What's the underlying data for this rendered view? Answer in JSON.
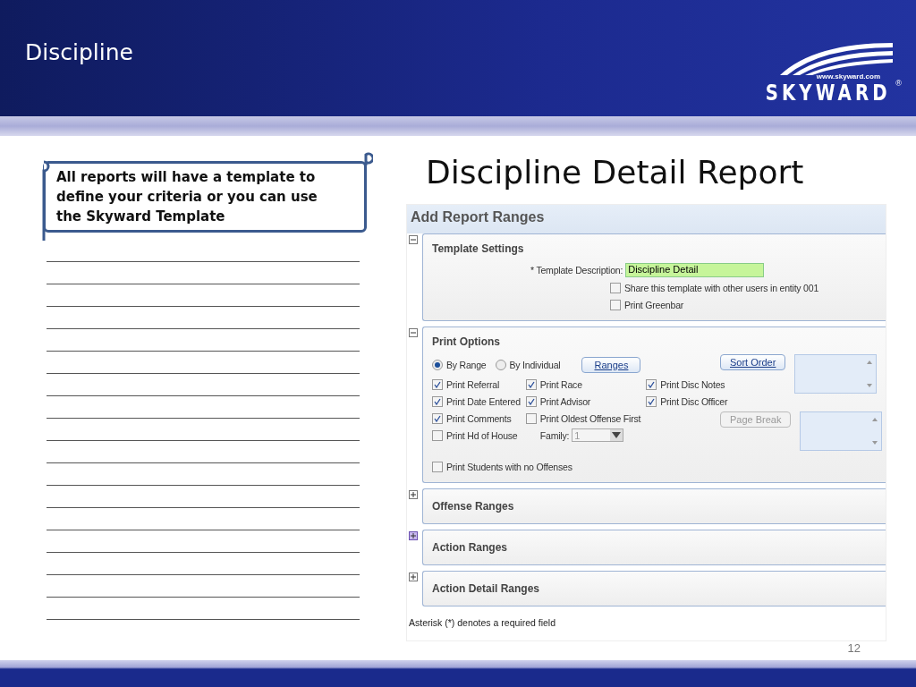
{
  "slide": {
    "title": "Discipline",
    "logo": {
      "url": "www.skyward.com",
      "name": "SKYWARD",
      "mark": "®"
    },
    "callout": "All reports will have a template to define your criteria or you can use the Skyward Template",
    "heading": "Discipline Detail Report",
    "page_number": "12"
  },
  "screenshot": {
    "title": "Add Report Ranges",
    "sections": [
      {
        "kind": "template",
        "title": "Template Settings",
        "expanded": true,
        "hovered": false,
        "required_mark": "*",
        "field_label": "Template Description:",
        "field_value": "Discipline Detail",
        "checkboxes": [
          {
            "label": "Share this template with other users in entity 001",
            "checked": false
          },
          {
            "label": "Print Greenbar",
            "checked": false
          }
        ]
      },
      {
        "kind": "print",
        "title": "Print Options",
        "expanded": true,
        "hovered": false,
        "radios": [
          {
            "label": "By Range",
            "selected": true
          },
          {
            "label": "By Individual",
            "selected": false
          }
        ],
        "ranges_button": "Ranges",
        "columns": [
          {
            "items": [
              {
                "kind": "checkbox",
                "label": "Print Referral",
                "checked": true
              },
              {
                "kind": "checkbox",
                "label": "Print Date Entered",
                "checked": true
              },
              {
                "kind": "checkbox",
                "label": "Print Comments",
                "checked": true
              },
              {
                "kind": "checkbox",
                "label": "Print Hd of House",
                "checked": false
              }
            ]
          },
          {
            "items": [
              {
                "kind": "checkbox",
                "label": "Print Race",
                "checked": true
              },
              {
                "kind": "checkbox",
                "label": "Print Advisor",
                "checked": true
              },
              {
                "kind": "checkbox",
                "label": "Print Oldest Offense First",
                "checked": false
              },
              {
                "kind": "select",
                "label": "Family:",
                "value": "1",
                "disabled": true
              }
            ]
          },
          {
            "items": [
              {
                "kind": "checkbox",
                "label": "Print Disc Notes",
                "checked": true
              },
              {
                "kind": "checkbox",
                "label": "Print Disc Officer",
                "checked": true
              }
            ]
          }
        ],
        "bottom_checkbox": {
          "label": "Print Students with no Offenses",
          "checked": false
        },
        "side_buttons": [
          {
            "label": "Sort Order",
            "disabled": false
          },
          {
            "label": "Page Break",
            "disabled": true
          }
        ]
      },
      {
        "kind": "collapsed",
        "title": "Offense Ranges",
        "expanded": false,
        "hovered": false
      },
      {
        "kind": "collapsed",
        "title": "Action Ranges",
        "expanded": false,
        "hovered": true
      },
      {
        "kind": "collapsed",
        "title": "Action Detail Ranges",
        "expanded": false,
        "hovered": false
      }
    ],
    "footnote": "Asterisk (*) denotes a required field"
  }
}
